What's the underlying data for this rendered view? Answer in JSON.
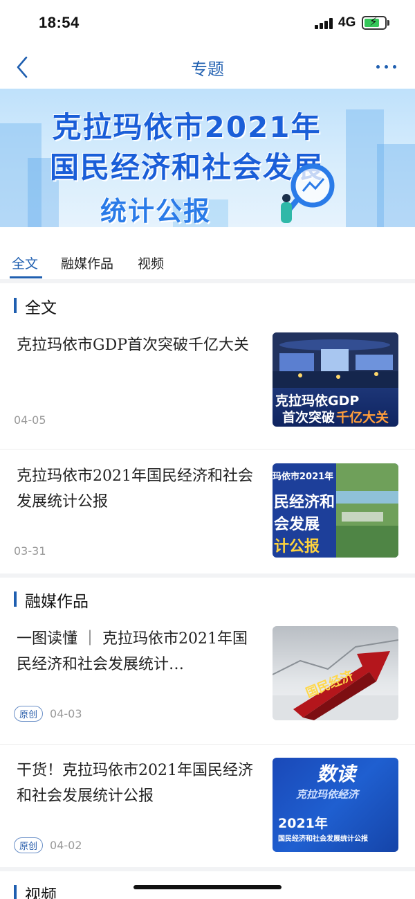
{
  "status_bar": {
    "time": "18:54",
    "network": "4G"
  },
  "nav": {
    "title": "专题"
  },
  "banner": {
    "line1": "克拉玛依市2021年",
    "line2": "国民经济和社会发展",
    "line3": "统计公报"
  },
  "tabs": [
    {
      "label": "全文",
      "active": true
    },
    {
      "label": "融媒作品",
      "active": false
    },
    {
      "label": "视频",
      "active": false
    }
  ],
  "sections": {
    "fulltext": {
      "title": "全文",
      "articles": [
        {
          "title": "克拉玛依市GDP首次突破千亿大关",
          "date": "04-05",
          "thumb": {
            "line1": "克拉玛依GDP",
            "line2a": "首次突破",
            "line2b": "千亿大关"
          }
        },
        {
          "title": "克拉玛依市2021年国民经济和社会发展统计公报",
          "date": "03-31",
          "thumb": {
            "top": "玛依市2021年",
            "line1": "民经济和",
            "line2": "会发展",
            "line3": "计公报"
          }
        }
      ]
    },
    "media": {
      "title": "融媒作品",
      "articles": [
        {
          "title": "一图读懂 ｜ 克拉玛依市2021年国民经济和社会发展统计…",
          "tag": "原创",
          "date": "04-03",
          "thumb": {
            "label": "国民经济"
          }
        },
        {
          "title": "干货！克拉玛依市2021年国民经济和社会发展统计公报",
          "tag": "原创",
          "date": "04-02",
          "thumb": {
            "big": "数读",
            "sub": "克拉玛依经济",
            "year": "2021年",
            "desc": "国民经济和社会发展统计公报"
          }
        }
      ]
    },
    "video": {
      "title": "视频"
    }
  },
  "colors": {
    "accent": "#1f5fb0",
    "banner_text": "#1a5ed8",
    "divider": "#f2f3f5"
  }
}
